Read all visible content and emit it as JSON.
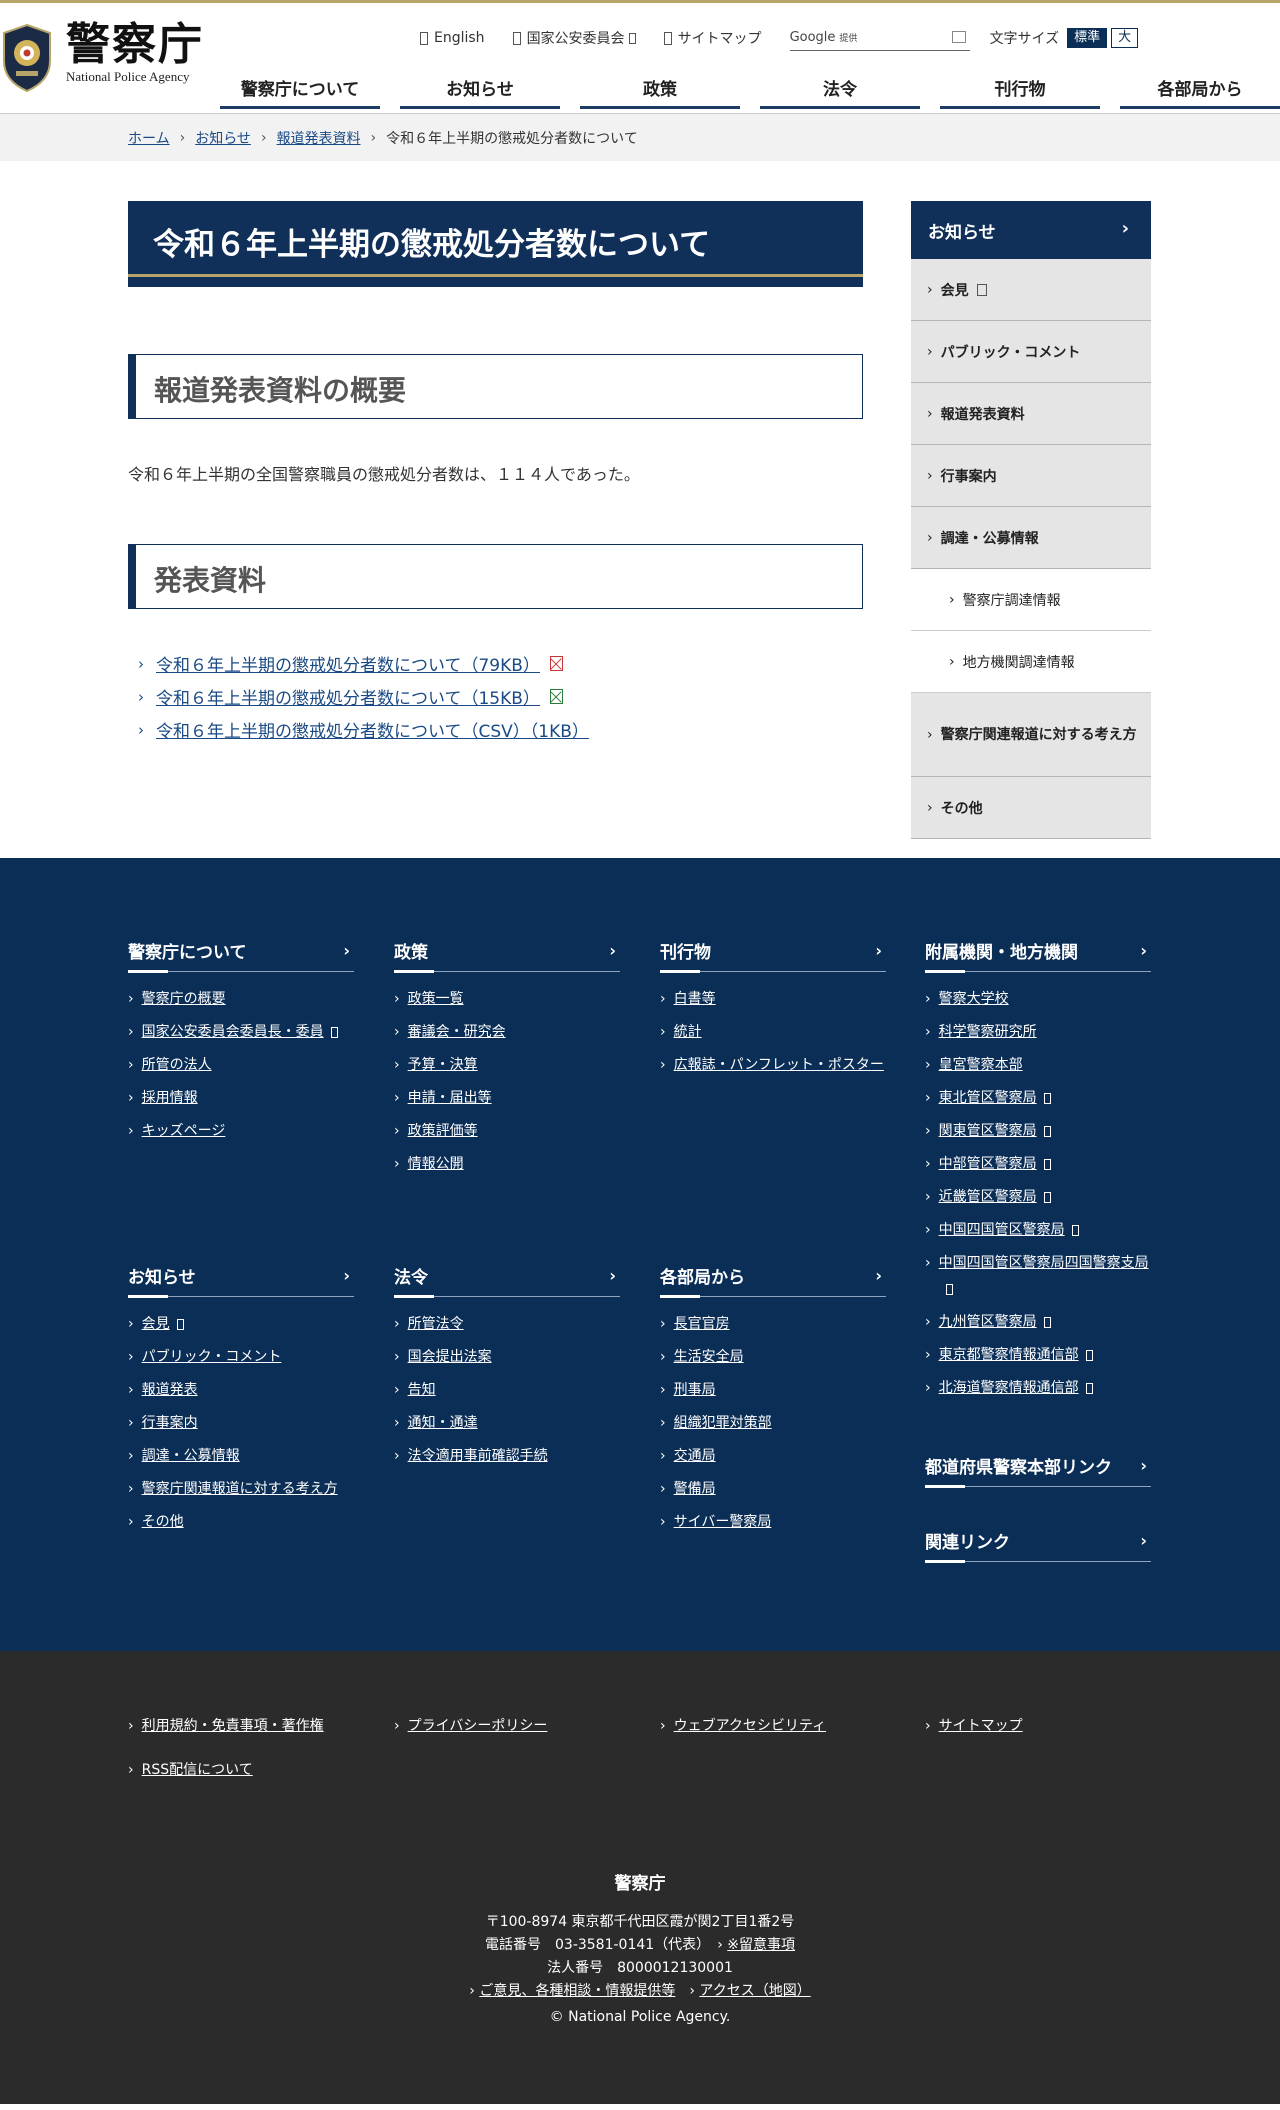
{
  "header": {
    "logo_kanji": "警察庁",
    "logo_en": "National Police Agency",
    "util_links": [
      "English",
      "国家公安委員会",
      "サイトマップ"
    ],
    "search": {
      "brand": "Google",
      "brand_sub": "提供",
      "placeholder": ""
    },
    "fontsize": {
      "label": "文字サイズ",
      "standard": "標準",
      "large": "大"
    },
    "gnav": [
      "警察庁について",
      "お知らせ",
      "政策",
      "法令",
      "刊行物",
      "各部局から"
    ]
  },
  "breadcrumb": {
    "items": [
      "ホーム",
      "お知らせ",
      "報道発表資料"
    ],
    "current": "令和６年上半期の懲戒処分者数について"
  },
  "main": {
    "title": "令和６年上半期の懲戒処分者数について",
    "overview_heading": "報道発表資料の概要",
    "overview_text": "令和６年上半期の全国警察職員の懲戒処分者数は、１１４人であった。",
    "documents_heading": "発表資料",
    "documents": [
      {
        "label": "令和６年上半期の懲戒処分者数について（79KB）",
        "icon": "pdf-icon"
      },
      {
        "label": "令和６年上半期の懲戒処分者数について（15KB）",
        "icon": "excel-icon"
      },
      {
        "label": "令和６年上半期の懲戒処分者数について（CSV）（1KB）",
        "icon": ""
      }
    ]
  },
  "side_menu": {
    "head": "お知らせ",
    "items": [
      "会見",
      "パブリック・コメント",
      "報道発表資料",
      "行事案内",
      "調達・公募情報",
      "警察庁調達情報",
      "地方機関調達情報",
      "警察庁関連報道に対する考え方",
      "その他"
    ]
  },
  "footer": {
    "col_about": {
      "head": "警察庁について",
      "items": [
        "警察庁の概要",
        "国家公安委員会委員長・委員",
        "所管の法人",
        "採用情報",
        "キッズページ"
      ]
    },
    "col_policy": {
      "head": "政策",
      "items": [
        "政策一覧",
        "審議会・研究会",
        "予算・決算",
        "申請・届出等",
        "政策評価等",
        "情報公開"
      ]
    },
    "col_pub": {
      "head": "刊行物",
      "items": [
        "白書等",
        "統計",
        "広報誌・パンフレット・ポスター"
      ]
    },
    "col_agencies": {
      "head": "附属機関・地方機関",
      "items": [
        "警察大学校",
        "科学警察研究所",
        "皇宮警察本部",
        "東北管区警察局",
        "関東管区警察局",
        "中部管区警察局",
        "近畿管区警察局",
        "中国四国管区警察局",
        "中国四国管区警察局四国警察支局",
        "九州管区警察局",
        "東京都警察情報通信部",
        "北海道警察情報通信部"
      ]
    },
    "col_news": {
      "head": "お知らせ",
      "items": [
        "会見",
        "パブリック・コメント",
        "報道発表",
        "行事案内",
        "調達・公募情報",
        "警察庁関連報道に対する考え方",
        "その他"
      ]
    },
    "col_law": {
      "head": "法令",
      "items": [
        "所管法令",
        "国会提出法案",
        "告知",
        "通知・通達",
        "法令適用事前確認手続"
      ]
    },
    "col_bureaus": {
      "head": "各部局から",
      "items": [
        "長官官房",
        "生活安全局",
        "刑事局",
        "組織犯罪対策部",
        "交通局",
        "警備局",
        "サイバー警察局"
      ]
    },
    "pref_link": "都道府県警察本部リンク",
    "related_link": "関連リンク"
  },
  "footer_bottom": {
    "links": [
      "利用規約・免責事項・著作権",
      "プライバシーポリシー",
      "ウェブアクセシビリティ",
      "サイトマップ",
      "RSS配信について"
    ],
    "org": "警察庁",
    "address": "〒100-8974 東京都千代田区霞が関2丁目1番2号",
    "phone": "電話番号　03-3581-0141（代表）",
    "notice_link": "※留意事項",
    "corp_no": "法人番号　8000012130001",
    "opinion_link": "ご意見、各種相談・情報提供等",
    "access_link": "アクセス（地図）",
    "copyright": "© National Police Agency."
  },
  "colors": {
    "navy": "#10305a",
    "footer_navy": "#0b2e57",
    "gold": "#b7a46a",
    "footer_dark": "#2b2b2b",
    "link": "#1a4a85"
  }
}
